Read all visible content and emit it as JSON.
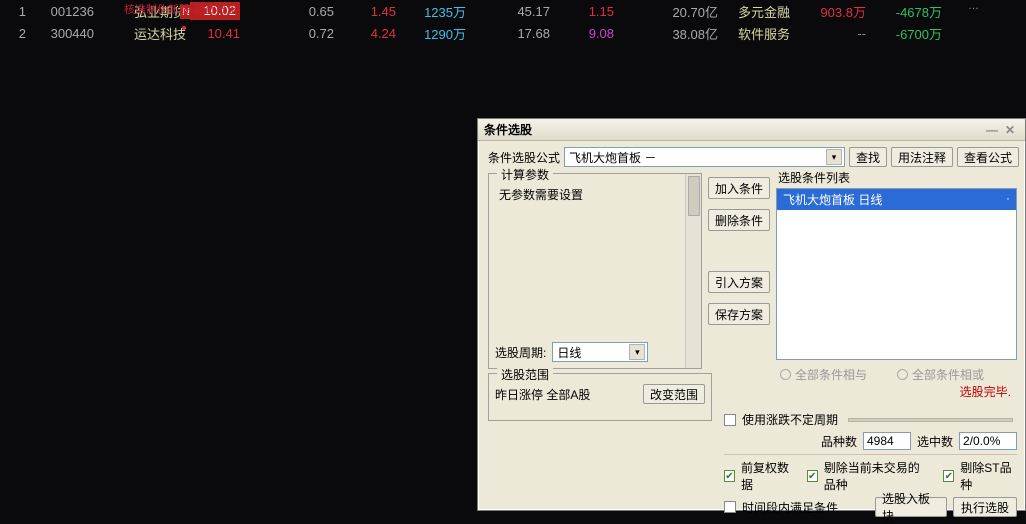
{
  "top_right_cut": "…",
  "overlay_text": "核准制伪新股·期货概念",
  "rows": [
    {
      "idx": "1",
      "code": "001236",
      "name": "弘业期货",
      "badge": "N",
      "price": "10.02",
      "price_bg": true,
      "chg": "0.65",
      "pct": "1.45",
      "vol": "1235万",
      "free": "45.17",
      "tr": "1.15",
      "tr_class": "red",
      "mkt": "20.70亿",
      "ind": "多元金融",
      "a": "903.8万",
      "a_class": "red",
      "b": "-4678万",
      "b_class": "green"
    },
    {
      "idx": "2",
      "code": "300440",
      "name": "运达科技",
      "badge": "",
      "price": "10.41",
      "price_bg": false,
      "chg": "0.72",
      "pct": "4.24",
      "vol": "1290万",
      "free": "17.68",
      "tr": "9.08",
      "tr_class": "magenta",
      "mkt": "38.08亿",
      "ind": "软件服务",
      "a": "--",
      "a_class": "grey",
      "b": "-6700万",
      "b_class": "green"
    }
  ],
  "dialog": {
    "title": "条件选股",
    "formula_label": "条件选股公式",
    "formula_value": "飞机大炮首板 －",
    "btn_search": "查找",
    "btn_usage": "用法注释",
    "btn_view": "查看公式",
    "fs_params": "计算参数",
    "no_params": "无参数需要设置",
    "period_label": "选股周期:",
    "period_value": "日线",
    "btn_add": "加入条件",
    "btn_del": "删除条件",
    "btn_import": "引入方案",
    "btn_save": "保存方案",
    "rc_label": "选股条件列表",
    "list_item": "飞机大炮首板   日线",
    "radio_and": "全部条件相与",
    "radio_or": "全部条件相或",
    "status": "选股完毕.",
    "fs_range": "选股范围",
    "range_text": "昨日涨停  全部A股",
    "btn_change_range": "改变范围",
    "cb_var_period": "使用涨跌不定周期",
    "count_label": "品种数",
    "count_value": "4984",
    "hit_label": "选中数",
    "hit_value": "2/0.0%",
    "cb_fq": "前复权数据",
    "cb_excl_nt": "剔除当前未交易的品种",
    "cb_excl_st": "剔除ST品种",
    "cb_time": "时间段内满足条件",
    "btn_to_block": "选股入板块",
    "btn_run": "执行选股"
  }
}
